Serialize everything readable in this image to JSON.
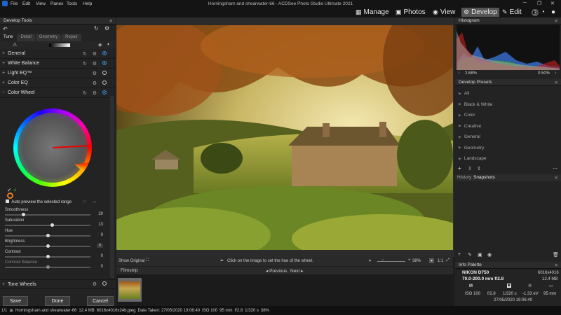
{
  "app": {
    "title": "Horningsham and shearwater-66 - ACDSee Photo Studio Ultimate 2021",
    "menus": [
      "File",
      "Edit",
      "View",
      "Panes",
      "Tools",
      "Help"
    ]
  },
  "modes": {
    "manage": "Manage",
    "photos": "Photos",
    "view": "View",
    "develop": "Develop",
    "edit": "Edit"
  },
  "left_panel": {
    "title": "Develop Tools",
    "tabs": [
      "Tune",
      "Detail",
      "Geometry",
      "Repair"
    ],
    "groups": {
      "general": "General",
      "white_balance": "White Balance",
      "light_eq": "Light EQ™",
      "color_eq": "Color EQ",
      "color_wheel": "Color Wheel",
      "tone_wheels": "Tone Wheels"
    },
    "auto_preview": "Auto preview the selected range",
    "sliders": [
      {
        "label": "Smoothness",
        "value": "20",
        "level": 0.2
      },
      {
        "label": "Saturation",
        "value": "13",
        "level": 0.55
      },
      {
        "label": "Hue",
        "value": "0",
        "level": 0.5
      },
      {
        "label": "Brightness",
        "value": "0",
        "level": 0.5
      },
      {
        "label": "Contrast",
        "value": "0",
        "level": 0.5
      },
      {
        "label": "Contrast Balance",
        "value": "0",
        "level": 0.5
      }
    ],
    "buttons": {
      "save": "Save",
      "done": "Done",
      "cancel": "Cancel"
    }
  },
  "photo_bar": {
    "show_original": "Show Original",
    "hint": "Click on the image to set the hue of the wheel.",
    "zoom": "38%",
    "fit": "1:1"
  },
  "filmstrip": {
    "title": "Filmstrip",
    "previous": "Previous",
    "next": "Next"
  },
  "right_panel": {
    "histogram_title": "Histogram",
    "hist_left": "2.68%",
    "hist_right": "0.50%",
    "presets_title": "Develop Presets",
    "presets": [
      "All",
      "Black & White",
      "Color",
      "Creative",
      "General",
      "Geometry",
      "Landscape"
    ],
    "history_tab": "History",
    "snapshots_tab": "Snapshots",
    "info_title": "Info Palette",
    "camera": "NIKON D750",
    "resolution": "6016x4016",
    "lens": "70.0-200.0 mm f/2.8",
    "filesize": "12.4 MB",
    "mode_letter": "M",
    "iso": "ISO 100",
    "aperture": "f/2.8",
    "shutter": "1/320 s",
    "ev": "-1.33 eV",
    "focal": "95 mm",
    "date": "27/05/2020 19:06:40"
  },
  "status": {
    "count": "1/1",
    "filename": "Horningsham and shearwater-66",
    "size": "12.4 MB",
    "fileinfo": "6016x4016x24b.jpeg",
    "date_taken": "Date Taken: 27/05/2020 19:06:40",
    "iso": "ISO 100",
    "focal": "95 mm",
    "aperture": "f/2.8",
    "shutter": "1/320 s",
    "zoom": "38%"
  },
  "colors": {
    "accent": "#3a8fe0",
    "panel": "#232323",
    "titlebar": "#141414"
  }
}
